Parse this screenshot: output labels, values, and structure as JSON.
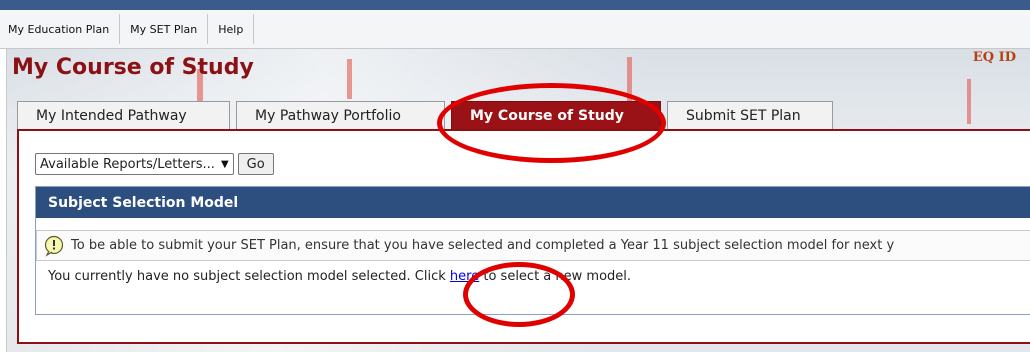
{
  "menu": {
    "items": [
      "My Education Plan",
      "My SET Plan",
      "Help"
    ]
  },
  "header": {
    "title": "My Course of Study",
    "eq_id": "EQ ID"
  },
  "tabs": [
    {
      "label": "My Intended Pathway",
      "active": false
    },
    {
      "label": "My Pathway Portfolio",
      "active": false
    },
    {
      "label": "My Course of Study",
      "active": true
    },
    {
      "label": "Submit SET Plan",
      "active": false
    }
  ],
  "reports": {
    "selected": "Available Reports/Letters...",
    "go_label": "Go"
  },
  "subject_model": {
    "title": "Subject Selection Model",
    "notice": "To be able to submit your SET Plan, ensure that you have selected and completed a Year 11 subject selection model for next y",
    "status_prefix": "You currently have no subject selection model selected.  Click",
    "link_label": "here",
    "status_suffix": "to select a new model."
  },
  "colors": {
    "brand_red": "#8b1114",
    "active_tab": "#9b1216",
    "header_blue": "#2d4f80",
    "annotation_red": "#e00000",
    "title_red": "#8b1114"
  }
}
